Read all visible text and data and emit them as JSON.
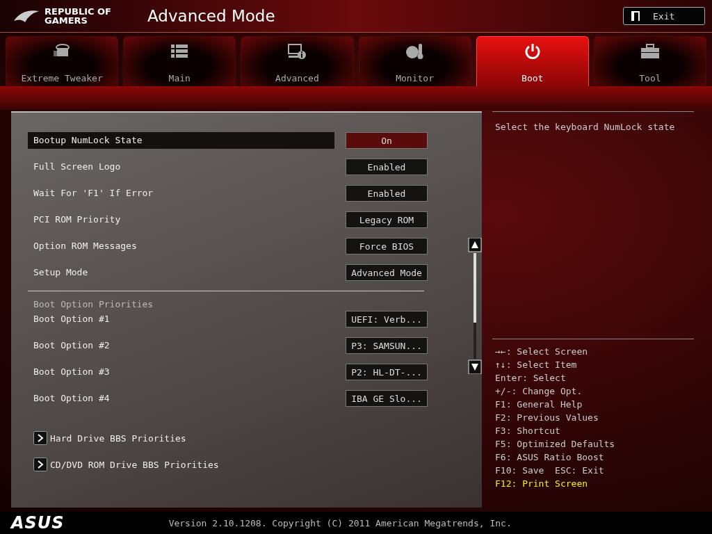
{
  "header": {
    "brand": [
      "REPUBLIC OF",
      "GAMERS"
    ],
    "title": "Advanced Mode",
    "exit_button": "Exit"
  },
  "tabs": [
    {
      "label": "Extreme Tweaker",
      "selected": false
    },
    {
      "label": "Main",
      "selected": false
    },
    {
      "label": "Advanced",
      "selected": false
    },
    {
      "label": "Monitor",
      "selected": false
    },
    {
      "label": "Boot",
      "selected": true
    },
    {
      "label": "Tool",
      "selected": false
    }
  ],
  "settings": [
    {
      "label": "Bootup NumLock State",
      "value": "On",
      "selected": true
    },
    {
      "label": "Full Screen Logo",
      "value": "Enabled",
      "selected": false
    },
    {
      "label": "Wait For 'F1' If Error",
      "value": "Enabled",
      "selected": false
    },
    {
      "label": "PCI ROM Priority",
      "value": "Legacy ROM",
      "selected": false
    },
    {
      "label": "Option ROM Messages",
      "value": "Force BIOS",
      "selected": false
    },
    {
      "label": "Setup Mode",
      "value": "Advanced Mode",
      "selected": false
    }
  ],
  "boot_priorities": {
    "heading": "Boot Option Priorities",
    "options": [
      {
        "label": "Boot Option #1",
        "value": "UEFI: Verb...",
        "selected": false
      },
      {
        "label": "Boot Option #2",
        "value": "P3: SAMSUN...",
        "selected": false
      },
      {
        "label": "Boot Option #3",
        "value": "P2: HL-DT-...",
        "selected": false
      },
      {
        "label": "Boot Option #4",
        "value": "IBA GE Slo...",
        "selected": false
      }
    ]
  },
  "submenus": [
    "Hard Drive BBS Priorities",
    "CD/DVD ROM Drive BBS Priorities"
  ],
  "help": {
    "description": "Select the keyboard NumLock state",
    "keys": [
      {
        "text": "→←: Select Screen",
        "highlighted": false
      },
      {
        "text": "↑↓: Select Item",
        "highlighted": false
      },
      {
        "text": "Enter: Select",
        "highlighted": false
      },
      {
        "text": "+/-: Change Opt.",
        "highlighted": false
      },
      {
        "text": "F1: General Help",
        "highlighted": false
      },
      {
        "text": "F2: Previous Values",
        "highlighted": false
      },
      {
        "text": "F3: Shortcut",
        "highlighted": false
      },
      {
        "text": "F5: Optimized Defaults",
        "highlighted": false
      },
      {
        "text": "F6: ASUS Ratio Boost",
        "highlighted": false
      },
      {
        "text": "F10: Save  ESC: Exit",
        "highlighted": false
      },
      {
        "text": "F12: Print Screen",
        "highlighted": true
      }
    ]
  },
  "footer": {
    "logo": "ASUS",
    "version": "Version 2.10.1208. Copyright (C) 2011 American Megatrends, Inc."
  }
}
